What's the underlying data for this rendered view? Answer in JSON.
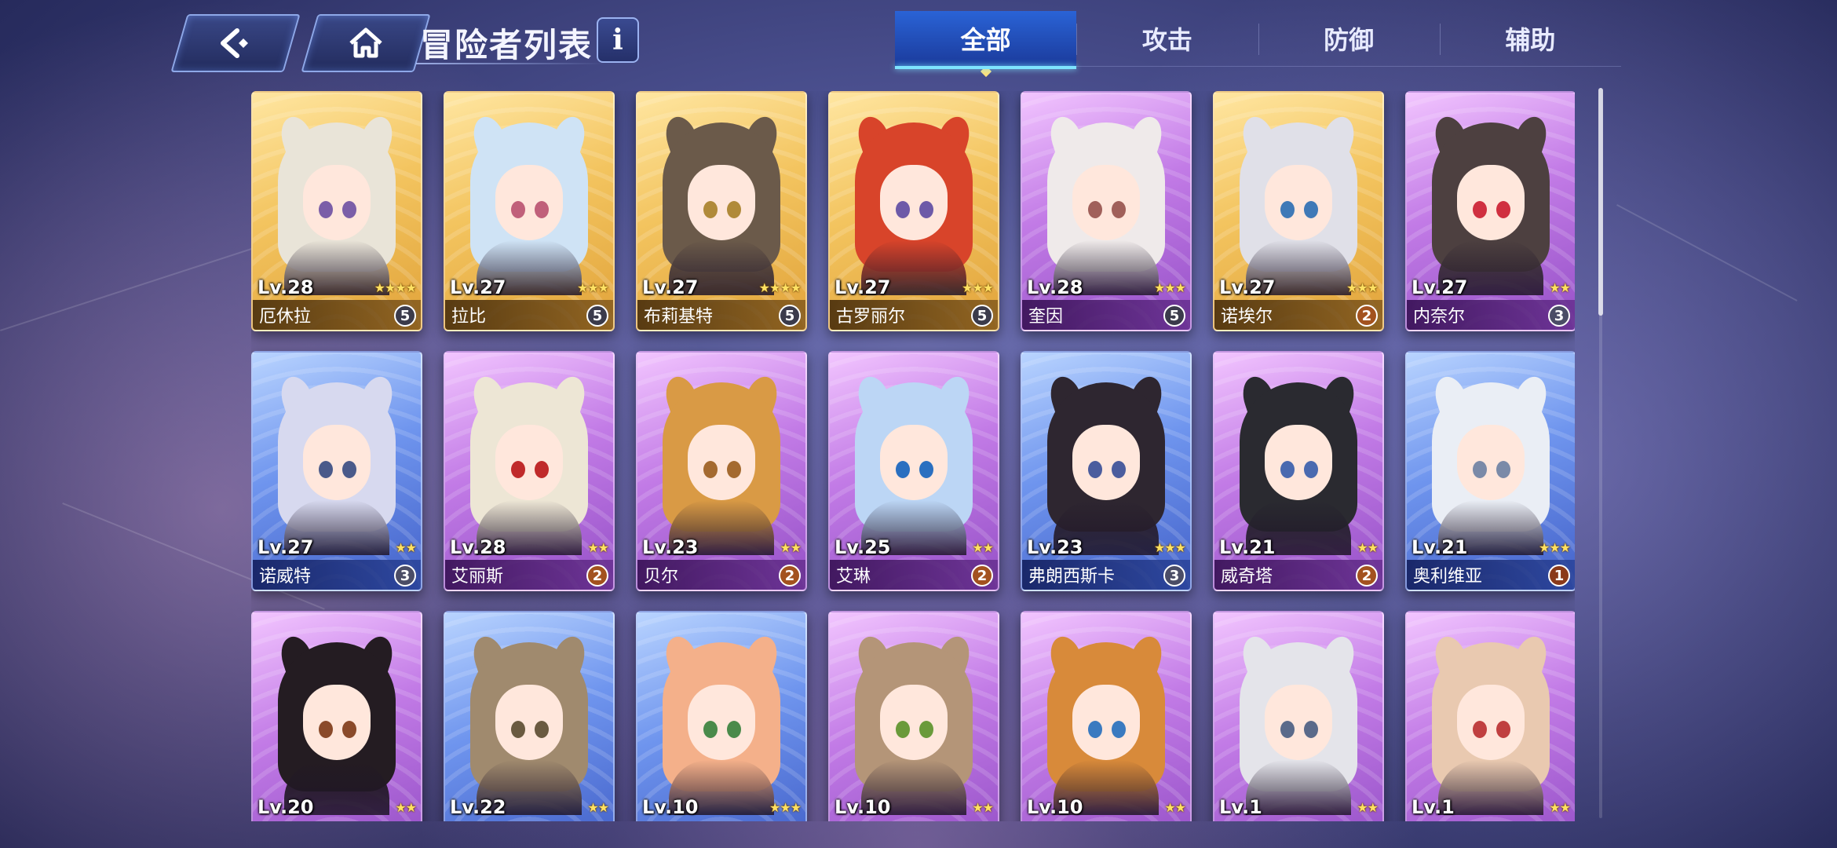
{
  "header": {
    "back_icon": "back-arrow-icon",
    "home_icon": "home-icon",
    "title": "冒险者列表",
    "info_label": "i"
  },
  "tabs": [
    {
      "label": "全部",
      "active": true
    },
    {
      "label": "攻击",
      "active": false
    },
    {
      "label": "防御",
      "active": false
    },
    {
      "label": "辅助",
      "active": false
    }
  ],
  "colors": {
    "tab_active": "#2a63d6",
    "gold_card": "#f3c45f",
    "purple_card": "#c27be6",
    "blue_card": "#6f95ee"
  },
  "cards": [
    {
      "level": "Lv.28",
      "name": "厄休拉",
      "stars": 4,
      "rank": "5",
      "rarity": "gold",
      "hair": "#e9e4d8",
      "eye": "#7b5ea8"
    },
    {
      "level": "Lv.27",
      "name": "拉比",
      "stars": 3,
      "rank": "5",
      "rarity": "gold",
      "hair": "#cfe3f5",
      "eye": "#c0607a"
    },
    {
      "level": "Lv.27",
      "name": "布莉基特",
      "stars": 4,
      "rank": "5",
      "rarity": "gold",
      "hair": "#6b5a4a",
      "eye": "#b08a3a"
    },
    {
      "level": "Lv.27",
      "name": "古罗丽尔",
      "stars": 3,
      "rank": "5",
      "rarity": "gold",
      "hair": "#d8442a",
      "eye": "#6d5aa8"
    },
    {
      "level": "Lv.28",
      "name": "奎因",
      "stars": 3,
      "rank": "5",
      "rarity": "purple",
      "hair": "#efeaea",
      "eye": "#a0605a"
    },
    {
      "level": "Lv.27",
      "name": "诺埃尔",
      "stars": 3,
      "rank": "2",
      "rarity": "gold",
      "hair": "#e0e0e8",
      "eye": "#3f79b7"
    },
    {
      "level": "Lv.27",
      "name": "内奈尔",
      "stars": 2,
      "rank": "3",
      "rarity": "purple",
      "hair": "#4d4040",
      "eye": "#d03040"
    },
    {
      "level": "Lv.27",
      "name": "诺威特",
      "stars": 2,
      "rank": "3",
      "rarity": "blue",
      "hair": "#d7d9ef",
      "eye": "#4a5a8a"
    },
    {
      "level": "Lv.28",
      "name": "艾丽斯",
      "stars": 2,
      "rank": "2",
      "rarity": "purple",
      "hair": "#ede6d5",
      "eye": "#c02a2a"
    },
    {
      "level": "Lv.23",
      "name": "贝尔",
      "stars": 2,
      "rank": "2",
      "rarity": "purple",
      "hair": "#d99a45",
      "eye": "#a46a30"
    },
    {
      "level": "Lv.25",
      "name": "艾琳",
      "stars": 2,
      "rank": "2",
      "rarity": "purple",
      "hair": "#bcd6f5",
      "eye": "#2a6fc0"
    },
    {
      "level": "Lv.23",
      "name": "弗朗西斯卡",
      "stars": 3,
      "rank": "3",
      "rarity": "blue",
      "hair": "#2e2630",
      "eye": "#4b5d9e"
    },
    {
      "level": "Lv.21",
      "name": "威奇塔",
      "stars": 2,
      "rank": "2",
      "rarity": "purple",
      "hair": "#2a2a30",
      "eye": "#4a6ab0"
    },
    {
      "level": "Lv.21",
      "name": "奥利维亚",
      "stars": 3,
      "rank": "1",
      "rarity": "blue",
      "hair": "#eaeef5",
      "eye": "#7a8aa8"
    },
    {
      "level": "Lv.20",
      "name": "",
      "stars": 2,
      "rank": "",
      "rarity": "purple",
      "hair": "#241c22",
      "eye": "#8a4a2a"
    },
    {
      "level": "Lv.22",
      "name": "",
      "stars": 2,
      "rank": "",
      "rarity": "blue",
      "hair": "#a08a6e",
      "eye": "#6a5a40"
    },
    {
      "level": "Lv.10",
      "name": "",
      "stars": 3,
      "rank": "",
      "rarity": "blue",
      "hair": "#f4b08a",
      "eye": "#4a8a4a"
    },
    {
      "level": "Lv.10",
      "name": "",
      "stars": 2,
      "rank": "",
      "rarity": "purple",
      "hair": "#b49578",
      "eye": "#6a9a3a"
    },
    {
      "level": "Lv.10",
      "name": "",
      "stars": 2,
      "rank": "",
      "rarity": "purple",
      "hair": "#d88a3a",
      "eye": "#3a7ac0"
    },
    {
      "level": "Lv.1",
      "name": "",
      "stars": 2,
      "rank": "",
      "rarity": "purple",
      "hair": "#e4e4ea",
      "eye": "#5a6a8a"
    },
    {
      "level": "Lv.1",
      "name": "",
      "stars": 2,
      "rank": "",
      "rarity": "purple",
      "hair": "#e9c9b0",
      "eye": "#c04040"
    }
  ]
}
